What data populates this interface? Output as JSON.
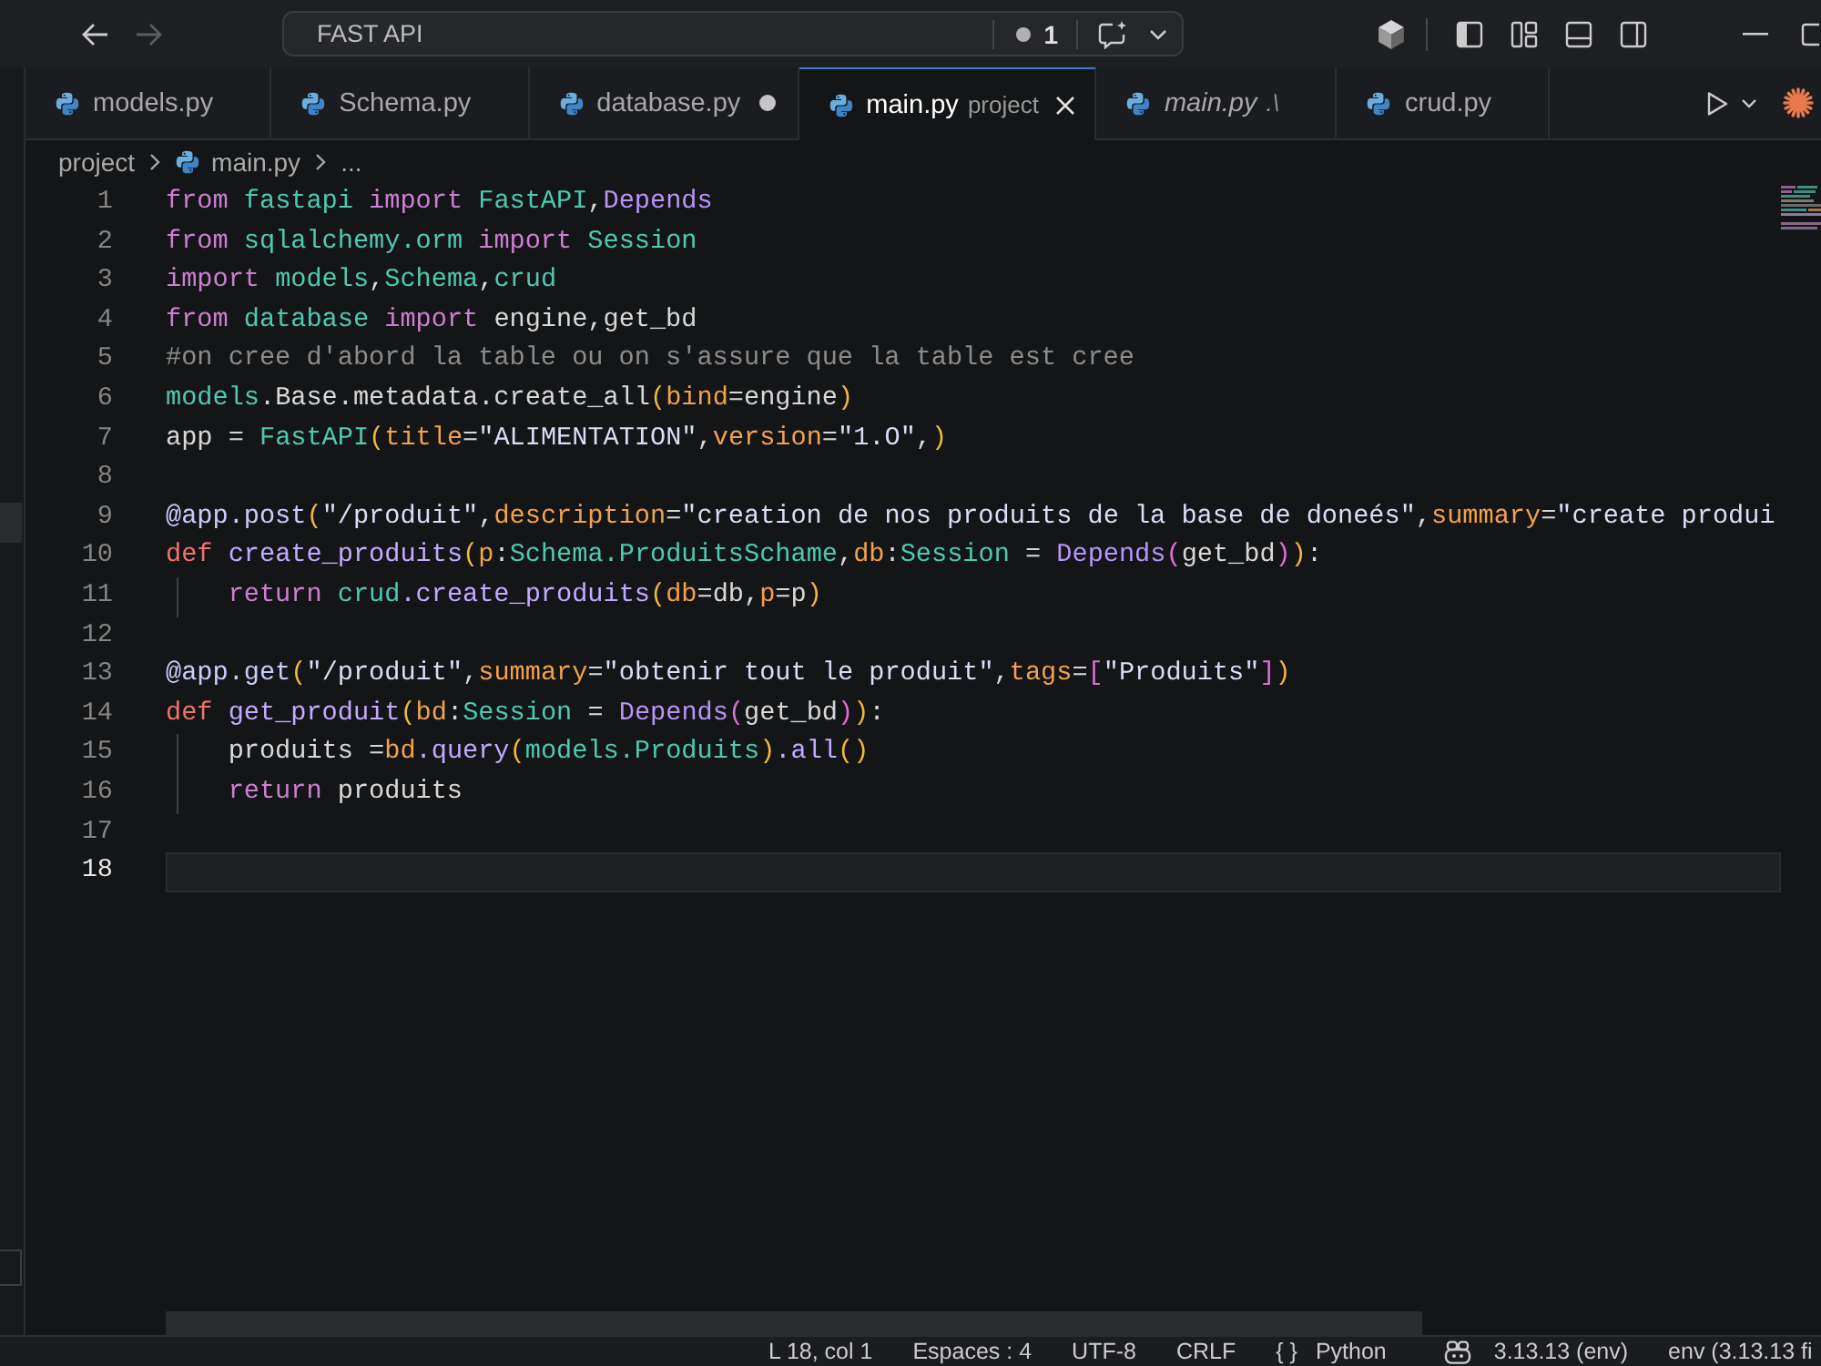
{
  "title_bar": {
    "nav": [
      {
        "kind": "back",
        "disabled": false
      },
      {
        "kind": "forward",
        "disabled": true
      }
    ],
    "command_center": {
      "title": "FAST API",
      "count": "1"
    }
  },
  "tabs": [
    {
      "label": "models.py",
      "selected": false,
      "modified": false,
      "preview": false
    },
    {
      "label": "Schema.py",
      "selected": false,
      "modified": false,
      "preview": false
    },
    {
      "label": "database.py",
      "selected": false,
      "modified": true,
      "preview": false
    },
    {
      "label": "main.py",
      "description": "project",
      "selected": true,
      "modified": false,
      "preview": false
    },
    {
      "label": "main.py",
      "description": ".\\",
      "selected": false,
      "modified": false,
      "preview": true
    },
    {
      "label": "crud.py",
      "selected": false,
      "modified": false,
      "preview": false
    }
  ],
  "breadcrumb": [
    {
      "kind": "folder",
      "label": "project"
    },
    {
      "kind": "file",
      "label": "main.py"
    },
    {
      "kind": "symbol",
      "label": "..."
    }
  ],
  "editor": {
    "lines": [
      {
        "number": "1",
        "current": false,
        "tokens": [
          {
            "text": "from ",
            "kind": "kw"
          },
          {
            "text": "fastapi ",
            "kind": "mod"
          },
          {
            "text": "import ",
            "kind": "kw"
          },
          {
            "text": "FastAPI",
            "kind": "mod"
          },
          {
            "text": ",",
            "kind": "plain"
          },
          {
            "text": "Depends",
            "kind": "cls"
          }
        ]
      },
      {
        "number": "2",
        "current": false,
        "tokens": [
          {
            "text": "from ",
            "kind": "kw"
          },
          {
            "text": "sqlalchemy.orm ",
            "kind": "mod"
          },
          {
            "text": "import ",
            "kind": "kw"
          },
          {
            "text": "Session",
            "kind": "mod"
          }
        ]
      },
      {
        "number": "3",
        "current": false,
        "tokens": [
          {
            "text": "import ",
            "kind": "kw"
          },
          {
            "text": "models",
            "kind": "mod"
          },
          {
            "text": ",",
            "kind": "plain"
          },
          {
            "text": "Schema",
            "kind": "mod"
          },
          {
            "text": ",",
            "kind": "plain"
          },
          {
            "text": "crud",
            "kind": "mod"
          }
        ]
      },
      {
        "number": "4",
        "current": false,
        "tokens": [
          {
            "text": "from ",
            "kind": "kw"
          },
          {
            "text": "database ",
            "kind": "mod"
          },
          {
            "text": "import ",
            "kind": "kw"
          },
          {
            "text": "engine,get_bd",
            "kind": "plain"
          }
        ]
      },
      {
        "number": "5",
        "current": false,
        "tokens": [
          {
            "text": "#on cree d'abord la table ou on s'assure que la table est cree",
            "kind": "com"
          }
        ]
      },
      {
        "number": "6",
        "current": false,
        "tokens": [
          {
            "text": "models",
            "kind": "mod"
          },
          {
            "text": ".Base.metadata.create_all",
            "kind": "plain"
          },
          {
            "text": "(",
            "kind": "b1"
          },
          {
            "text": "bind",
            "kind": "param"
          },
          {
            "text": "=engine",
            "kind": "plain"
          },
          {
            "text": ")",
            "kind": "b1"
          }
        ]
      },
      {
        "number": "7",
        "current": false,
        "tokens": [
          {
            "text": "app = ",
            "kind": "plain"
          },
          {
            "text": "FastAPI",
            "kind": "mod"
          },
          {
            "text": "(",
            "kind": "b1"
          },
          {
            "text": "title",
            "kind": "param"
          },
          {
            "text": "=",
            "kind": "plain"
          },
          {
            "text": "\"ALIMENTATION\"",
            "kind": "str"
          },
          {
            "text": ",",
            "kind": "plain"
          },
          {
            "text": "version",
            "kind": "param"
          },
          {
            "text": "=",
            "kind": "plain"
          },
          {
            "text": "\"1.O\"",
            "kind": "str"
          },
          {
            "text": ",",
            "kind": "plain"
          },
          {
            "text": ")",
            "kind": "b1"
          }
        ]
      },
      {
        "number": "8",
        "current": false
      },
      {
        "number": "9",
        "current": false,
        "tokens": [
          {
            "text": "@app.post",
            "kind": "deco"
          },
          {
            "text": "(",
            "kind": "b1"
          },
          {
            "text": "\"/produit\"",
            "kind": "str"
          },
          {
            "text": ",",
            "kind": "plain"
          },
          {
            "text": "description",
            "kind": "param"
          },
          {
            "text": "=",
            "kind": "plain"
          },
          {
            "text": "\"creation de nos produits de la base de doneés\"",
            "kind": "str"
          },
          {
            "text": ",",
            "kind": "plain"
          },
          {
            "text": "summary",
            "kind": "param"
          },
          {
            "text": "=",
            "kind": "plain"
          },
          {
            "text": "\"create produi",
            "kind": "str"
          }
        ]
      },
      {
        "number": "10",
        "current": false,
        "tokens": [
          {
            "text": "def ",
            "kind": "def"
          },
          {
            "text": "create_produits",
            "kind": "fn"
          },
          {
            "text": "(",
            "kind": "b1"
          },
          {
            "text": "p",
            "kind": "param"
          },
          {
            "text": ":",
            "kind": "plain"
          },
          {
            "text": "Schema.ProduitsSchame",
            "kind": "mod"
          },
          {
            "text": ",",
            "kind": "plain"
          },
          {
            "text": "db",
            "kind": "param"
          },
          {
            "text": ":",
            "kind": "plain"
          },
          {
            "text": "Session",
            "kind": "mod"
          },
          {
            "text": " = ",
            "kind": "plain"
          },
          {
            "text": "Depends",
            "kind": "cls"
          },
          {
            "text": "(",
            "kind": "b2"
          },
          {
            "text": "get_bd",
            "kind": "plain"
          },
          {
            "text": ")",
            "kind": "b2"
          },
          {
            "text": ")",
            "kind": "b1"
          },
          {
            "text": ":",
            "kind": "plain"
          }
        ],
        "children": [
          {
            "number": "11",
            "current": false,
            "tokens": [
              {
                "text": "return ",
                "kind": "kw"
              },
              {
                "text": "crud",
                "kind": "mod"
              },
              {
                "text": ".create_produits",
                "kind": "fn"
              },
              {
                "text": "(",
                "kind": "b1"
              },
              {
                "text": "db",
                "kind": "param"
              },
              {
                "text": "=db,",
                "kind": "plain"
              },
              {
                "text": "p",
                "kind": "param"
              },
              {
                "text": "=p",
                "kind": "plain"
              },
              {
                "text": ")",
                "kind": "b1"
              }
            ]
          }
        ]
      },
      {
        "number": "12",
        "current": false
      },
      {
        "number": "13",
        "current": false,
        "tokens": [
          {
            "text": "@app.get",
            "kind": "deco"
          },
          {
            "text": "(",
            "kind": "b1"
          },
          {
            "text": "\"/produit\"",
            "kind": "str"
          },
          {
            "text": ",",
            "kind": "plain"
          },
          {
            "text": "summary",
            "kind": "param"
          },
          {
            "text": "=",
            "kind": "plain"
          },
          {
            "text": "\"obtenir tout le produit\"",
            "kind": "str"
          },
          {
            "text": ",",
            "kind": "plain"
          },
          {
            "text": "tags",
            "kind": "param"
          },
          {
            "text": "=",
            "kind": "plain"
          },
          {
            "text": "[",
            "kind": "b2"
          },
          {
            "text": "\"Produits\"",
            "kind": "str"
          },
          {
            "text": "]",
            "kind": "b2"
          },
          {
            "text": ")",
            "kind": "b1"
          }
        ]
      },
      {
        "number": "14",
        "current": false,
        "tokens": [
          {
            "text": "def ",
            "kind": "def"
          },
          {
            "text": "get_produit",
            "kind": "fn"
          },
          {
            "text": "(",
            "kind": "b1"
          },
          {
            "text": "bd",
            "kind": "param"
          },
          {
            "text": ":",
            "kind": "plain"
          },
          {
            "text": "Session",
            "kind": "mod"
          },
          {
            "text": " = ",
            "kind": "plain"
          },
          {
            "text": "Depends",
            "kind": "cls"
          },
          {
            "text": "(",
            "kind": "b2"
          },
          {
            "text": "get_bd",
            "kind": "plain"
          },
          {
            "text": ")",
            "kind": "b2"
          },
          {
            "text": ")",
            "kind": "b1"
          },
          {
            "text": ":",
            "kind": "plain"
          }
        ],
        "children": [
          {
            "number": "15",
            "current": false,
            "tokens": [
              {
                "text": "produits =",
                "kind": "plain"
              },
              {
                "text": "bd",
                "kind": "param"
              },
              {
                "text": ".query",
                "kind": "fn"
              },
              {
                "text": "(",
                "kind": "b1"
              },
              {
                "text": "models.Produits",
                "kind": "mod"
              },
              {
                "text": ")",
                "kind": "b1"
              },
              {
                "text": ".all",
                "kind": "fn"
              },
              {
                "text": "()",
                "kind": "b1"
              }
            ]
          },
          {
            "number": "16",
            "current": false,
            "tokens": [
              {
                "text": "return ",
                "kind": "kw"
              },
              {
                "text": "produits",
                "kind": "plain"
              }
            ]
          }
        ]
      },
      {
        "number": "17",
        "current": false
      },
      {
        "number": "18",
        "current": true
      }
    ]
  },
  "status_bar": {
    "cursor": "L 18, col 1",
    "indentation": "Espaces : 4",
    "encoding": "UTF-8",
    "line_ending": "CRLF",
    "language_icon": "{ }",
    "language": "Python",
    "interpreter": "3.13.13 (env)",
    "environment": "env (3.13.13 fi"
  }
}
